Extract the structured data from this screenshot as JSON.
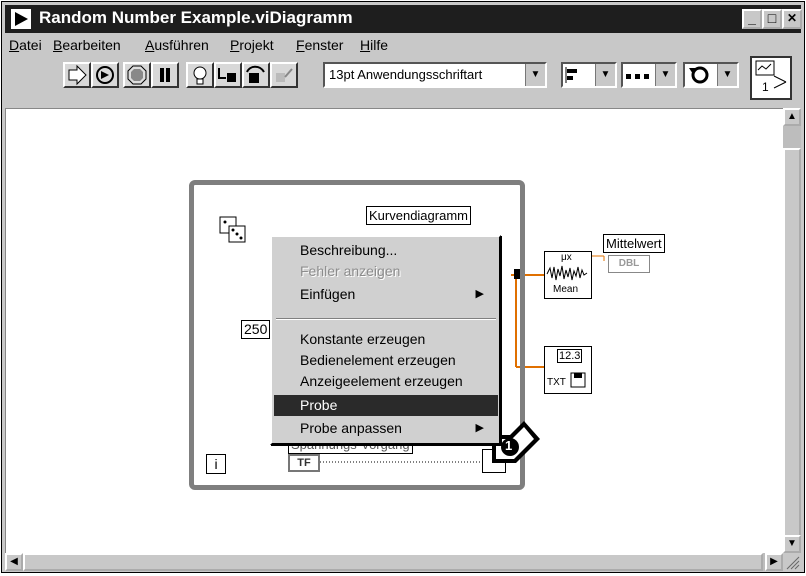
{
  "window": {
    "title": "Random Number Example.viDiagramm"
  },
  "titlebar": {
    "minimize": "_",
    "maximize": "□",
    "close": "✕"
  },
  "menubar": {
    "items": [
      "Datei",
      "Bearbeiten",
      "Ausführen",
      "Projekt",
      "Fenster",
      "Hilfe"
    ]
  },
  "toolbar": {
    "font_combo": "13pt Anwendungsschriftart",
    "run_icon": "run-arrow-icon",
    "run_continuous_icon": "run-continuous-icon",
    "abort_icon": "abort-icon",
    "pause_icon": "pause-icon",
    "highlight_icon": "lightbulb-icon",
    "retain_icon": "retain-wire-values-icon",
    "step_into_icon": "step-into-icon",
    "step_over_icon": "step-over-icon",
    "step_out_icon": "step-out-icon",
    "align_icon": "align-objects-icon",
    "distribute_icon": "distribute-objects-icon",
    "reorder_icon": "reorder-icon"
  },
  "connector_pane": {
    "label": "1"
  },
  "diagram": {
    "chart_label": "Kurvendiagramm",
    "mean_label": "Mittelwert",
    "mean_indicator": "DBL",
    "mean_vi_text": "Mean",
    "mean_vi_sym": "μx",
    "write_vi_top": "12.3",
    "write_vi_bottom": "TXT",
    "constant_250": "250",
    "iteration_terminal": "i",
    "boolean_label": "Spannungs-Vorgang",
    "boolean_value": "TF",
    "callout": "1"
  },
  "context_menu": {
    "items": [
      {
        "label": "Beschreibung...",
        "state": "normal"
      },
      {
        "label": "Fehler anzeigen",
        "state": "disabled"
      },
      {
        "label": "Einfügen",
        "state": "submenu"
      },
      {
        "label": "Konstante erzeugen",
        "state": "normal"
      },
      {
        "label": "Bedienelement erzeugen",
        "state": "normal"
      },
      {
        "label": "Anzeigeelement erzeugen",
        "state": "normal"
      },
      {
        "label": "Probe",
        "state": "selected"
      },
      {
        "label": "Probe anpassen",
        "state": "submenu"
      }
    ]
  },
  "colors": {
    "selection": "#2a2a2a",
    "loop_border": "#7f7f7f",
    "wire_orange": "#e07000"
  }
}
